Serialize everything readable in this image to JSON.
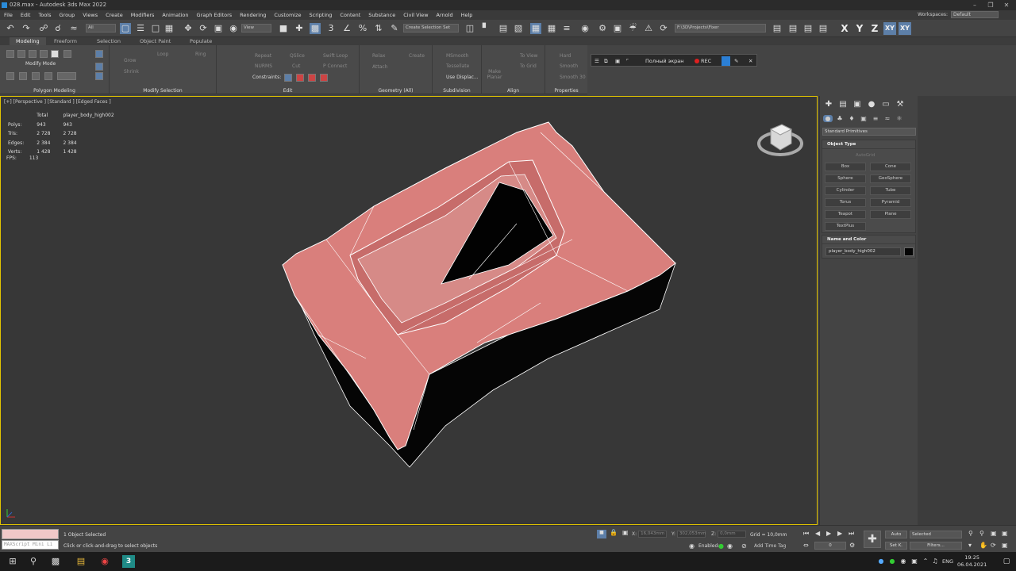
{
  "window": {
    "title": "028.max - Autodesk 3ds Max 2022"
  },
  "menu": {
    "items": [
      "File",
      "Edit",
      "Tools",
      "Group",
      "Views",
      "Create",
      "Modifiers",
      "Animation",
      "Graph Editors",
      "Rendering",
      "Customize",
      "Scripting",
      "Content",
      "Substance",
      "Civil View",
      "Arnold",
      "Help"
    ],
    "workspaces_label": "Workspaces:",
    "workspaces_value": "Default"
  },
  "toolbar": {
    "filter_dropdown": "All",
    "refcoord_dropdown": "View",
    "selection_set": "Create Selection Set",
    "project_path": "F:\\3D\\Projects\\Fixer",
    "axes": [
      "X",
      "Y",
      "Z",
      "XY",
      "XY"
    ]
  },
  "ribbon": {
    "tabs": [
      "Modeling",
      "Freeform",
      "Selection",
      "Object Paint",
      "Populate"
    ],
    "active_tab": "Modeling",
    "groups": [
      "Polygon Modeling",
      "Modify Selection",
      "Edit",
      "Geometry (All)",
      "Subdivision",
      "Align",
      "Properties"
    ],
    "modify_mode": "Modify Mode",
    "labels": {
      "grow": "Grow",
      "shrink": "Shrink",
      "loop": "Loop",
      "ring": "Ring",
      "repeat": "Repeat",
      "qslice": "QSlice",
      "swift_loop": "Swift Loop",
      "nurms": "NURMS",
      "cut": "Cut",
      "p_connect": "P Connect",
      "constraints": "Constraints:",
      "relax": "Relax",
      "create": "Create",
      "attach": "Attach",
      "msmooth": "MSmooth",
      "tessellate": "Tessellate",
      "use_displac": "Use Displac...",
      "make_planar": "Make Planar",
      "to_view": "To View",
      "to_grid": "To Grid",
      "hard": "Hard",
      "smooth": "Smooth",
      "smooth30": "Smooth 30"
    }
  },
  "recorder": {
    "fullscreen": "Полный экран",
    "rec": "REC"
  },
  "viewport": {
    "label": "[+] [Perspective ] [Standard ] [Edged Faces ]",
    "stats_header": [
      "",
      "Total",
      "player_body_high002"
    ],
    "stats_rows": [
      [
        "Polys:",
        "943",
        "943"
      ],
      [
        "Tris:",
        "2 728",
        "2 728"
      ],
      [
        "Edges:",
        "2 384",
        "2 384"
      ],
      [
        "Verts:",
        "1 428",
        "1 428"
      ]
    ],
    "fps_label": "FPS:",
    "fps_value": "113",
    "mesh_color": "#d97f7c"
  },
  "command_panel": {
    "category": "Standard Primitives",
    "object_type_title": "Object Type",
    "autogrid": "AutoGrid",
    "buttons": [
      "Box",
      "Cone",
      "Sphere",
      "GeoSphere",
      "Cylinder",
      "Tube",
      "Torus",
      "Pyramid",
      "Teapot",
      "Plane",
      "TextPlus"
    ],
    "name_color_title": "Name and Color",
    "object_name": "player_body_high002",
    "object_color": "#050505"
  },
  "status": {
    "maxscript": "MAXScript Mini Li",
    "selection": "1 Object Selected",
    "prompt": "Click or click-and-drag to select objects",
    "x_label": "X:",
    "x_value": "16,043mm",
    "y_label": "Y:",
    "y_value": "302,053mm",
    "z_label": "Z:",
    "z_value": "0,0mm",
    "grid": "Grid = 10,0mm",
    "enabled": "Enabled:",
    "add_time_tag": "Add Time Tag",
    "auto": "Auto",
    "set_k": "Set K.",
    "selected": "Selected",
    "filters": "Filters...",
    "frame": "0"
  },
  "taskbar": {
    "lang": "ENG",
    "time": "19:25",
    "date": "06.04.2021"
  }
}
